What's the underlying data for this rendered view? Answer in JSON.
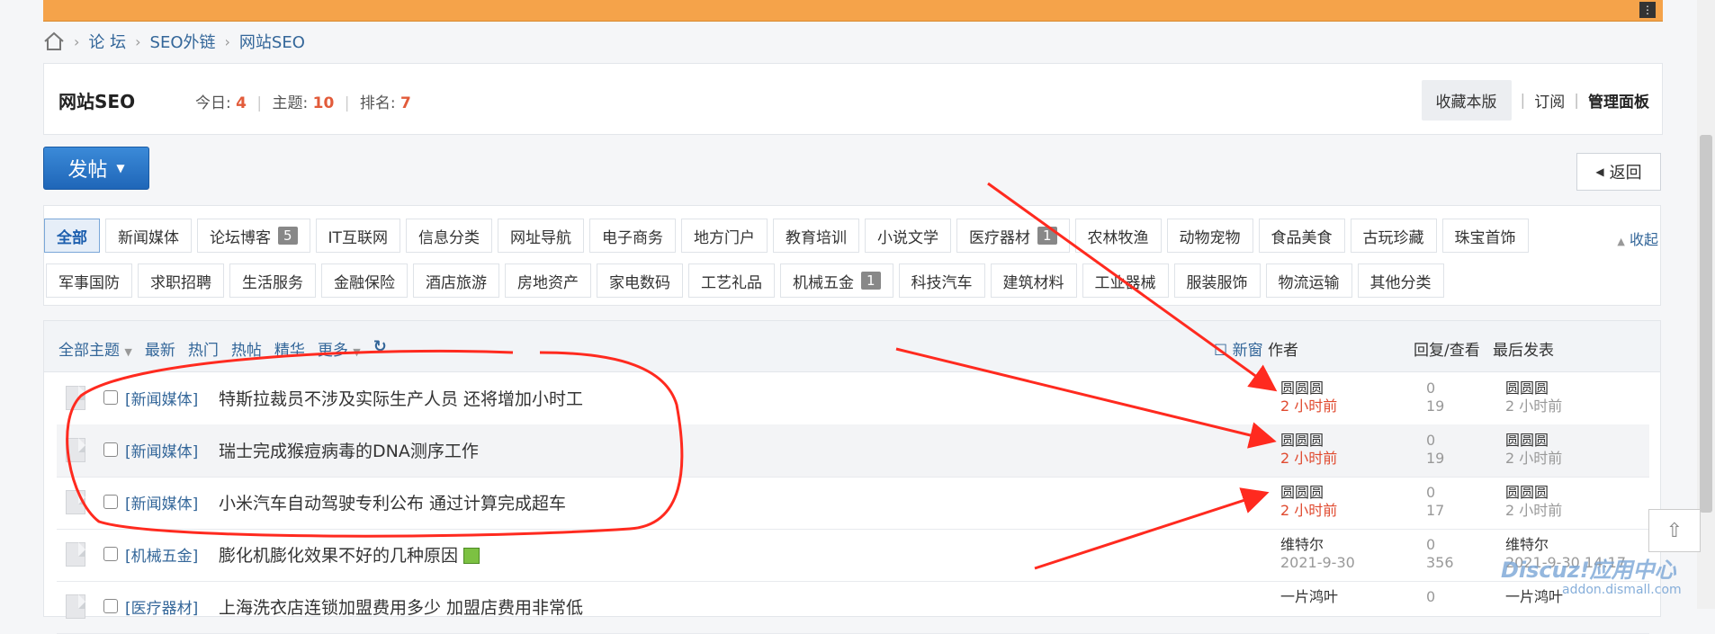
{
  "breadcrumb": {
    "items": [
      "论 坛",
      "SEO外链",
      "网站SEO"
    ]
  },
  "forum": {
    "name": "网站SEO",
    "today_label": "今日:",
    "today": "4",
    "topics_label": "主题:",
    "topics": "10",
    "rank_label": "排名:",
    "rank": "7",
    "fav_label": "收藏本版",
    "subscribe_label": "订阅",
    "manage_label": "管理面板"
  },
  "actions": {
    "post_label": "发帖",
    "back_label": "返回"
  },
  "types": {
    "row1": [
      {
        "label": "全部",
        "active": true
      },
      {
        "label": "新闻媒体"
      },
      {
        "label": "论坛博客",
        "badge": "5"
      },
      {
        "label": "IT互联网"
      },
      {
        "label": "信息分类"
      },
      {
        "label": "网址导航"
      },
      {
        "label": "电子商务"
      },
      {
        "label": "地方门户"
      },
      {
        "label": "教育培训"
      },
      {
        "label": "小说文学"
      },
      {
        "label": "医疗器材",
        "badge": "1"
      },
      {
        "label": "农林牧渔"
      },
      {
        "label": "动物宠物"
      },
      {
        "label": "食品美食"
      },
      {
        "label": "古玩珍藏"
      },
      {
        "label": "珠宝首饰"
      }
    ],
    "row2": [
      {
        "label": "军事国防"
      },
      {
        "label": "求职招聘"
      },
      {
        "label": "生活服务"
      },
      {
        "label": "金融保险"
      },
      {
        "label": "酒店旅游"
      },
      {
        "label": "房地资产"
      },
      {
        "label": "家电数码"
      },
      {
        "label": "工艺礼品"
      },
      {
        "label": "机械五金",
        "badge": "1"
      },
      {
        "label": "科技汽车"
      },
      {
        "label": "建筑材料"
      },
      {
        "label": "工业器械"
      },
      {
        "label": "服装服饰"
      },
      {
        "label": "物流运输"
      },
      {
        "label": "其他分类"
      }
    ],
    "collapse_label": "收起"
  },
  "list_header": {
    "all_topics": "全部主题",
    "latest": "最新",
    "hot": "热门",
    "hot_posts": "热帖",
    "digest": "精华",
    "more": "更多",
    "new_window": "新窗",
    "col_author": "作者",
    "col_reply_view": "回复/查看",
    "col_last": "最后发表"
  },
  "threads": [
    {
      "category": "[新闻媒体]",
      "title": "特斯拉裁员不涉及实际生产人员 还将增加小时工",
      "author": "圆圆圆",
      "time": "2 小时前",
      "replies": "0",
      "views": "19",
      "last_user": "圆圆圆",
      "last_time": "2 小时前"
    },
    {
      "category": "[新闻媒体]",
      "title": "瑞士完成猴痘病毒的DNA测序工作",
      "author": "圆圆圆",
      "time": "2 小时前",
      "replies": "0",
      "views": "19",
      "last_user": "圆圆圆",
      "last_time": "2 小时前"
    },
    {
      "category": "[新闻媒体]",
      "title": "小米汽车自动驾驶专利公布 通过计算完成超车",
      "author": "圆圆圆",
      "time": "2 小时前",
      "replies": "0",
      "views": "17",
      "last_user": "圆圆圆",
      "last_time": "2 小时前"
    },
    {
      "category": "[机械五金]",
      "title": "膨化机膨化效果不好的几种原因",
      "author": "维特尔",
      "time": "2021-9-30",
      "replies": "0",
      "views": "356",
      "last_user": "维特尔",
      "last_time": "2021-9-30 14:17"
    },
    {
      "category": "[医疗器材]",
      "title": "上海洗衣店连锁加盟费用多少 加盟店费用非常低",
      "author": "一片鸿叶",
      "time": "",
      "replies": "0",
      "views": "",
      "last_user": "一片鸿叶",
      "last_time": ""
    }
  ],
  "watermark": {
    "brand": "Discuz!应用中心",
    "domain": "addon.dismall.com"
  },
  "colors": {
    "accent": "#1f66b8",
    "highlight": "#e04a2f",
    "annotation": "#ff2a1f"
  }
}
